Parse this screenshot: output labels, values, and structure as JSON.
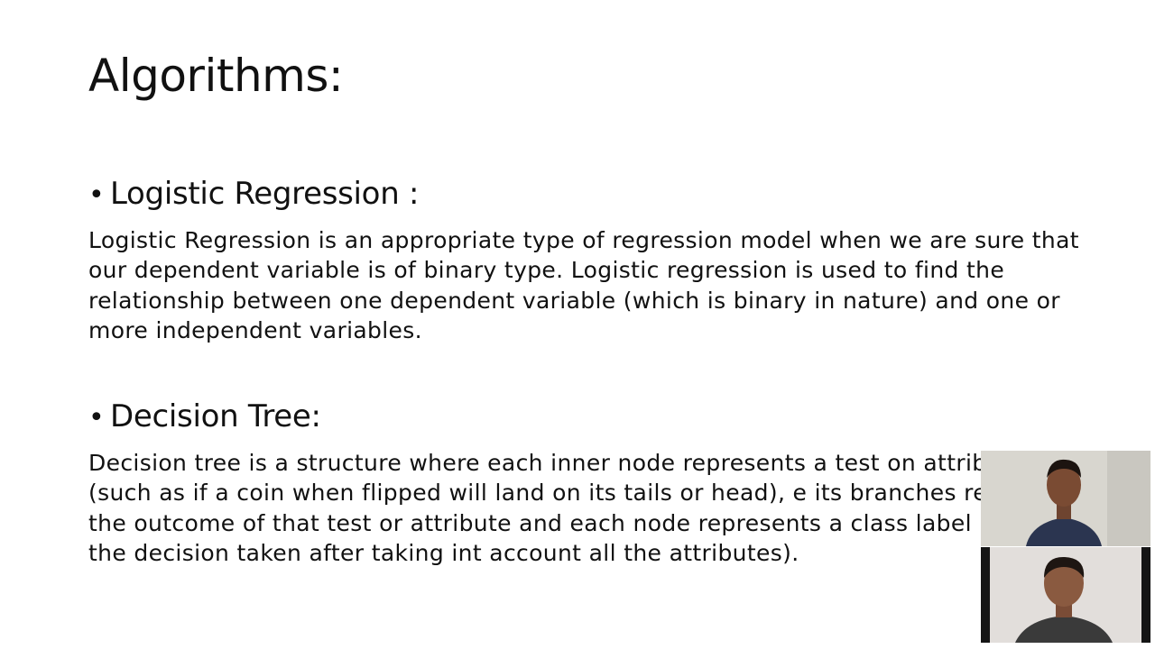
{
  "slide": {
    "title": "Algorithms:",
    "sections": [
      {
        "bullet": "•",
        "heading": "Logistic Regression :",
        "text": "Logistic Regression is an appropriate type of regression model when we are sure that our dependent variable is of binary type. Logistic regression is used to find the relationship between one dependent variable (which is binary in nature) and one or more independent variables."
      },
      {
        "bullet": "•",
        "heading": "Decision Tree:",
        "text": "Decision tree is a structure where each inner node represents a test on attribute (such as if a coin when flipped will land on its tails or head), e its branches represents the outcome of that test or attribute and each node represents a class label (that is the decision taken after taking int account all the attributes)."
      }
    ]
  },
  "video_tiles": [
    {
      "name": "participant-1",
      "bg": "#d8d6cf",
      "shirt": "#2b3550",
      "skin": "#7a4b33"
    },
    {
      "name": "participant-2",
      "bg": "#e2dedb",
      "shirt": "#3a3a3a",
      "skin": "#8a5a40"
    }
  ]
}
